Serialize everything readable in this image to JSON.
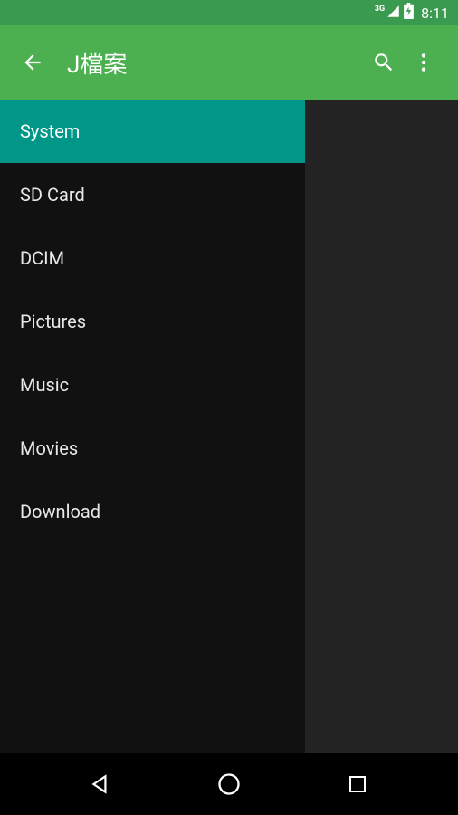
{
  "statusBar": {
    "networkType": "3G",
    "time": "8:11"
  },
  "appBar": {
    "title": "J檔案"
  },
  "drawer": {
    "items": [
      {
        "label": "System",
        "selected": true
      },
      {
        "label": "SD Card",
        "selected": false
      },
      {
        "label": "DCIM",
        "selected": false
      },
      {
        "label": "Pictures",
        "selected": false
      },
      {
        "label": "Music",
        "selected": false
      },
      {
        "label": "Movies",
        "selected": false
      },
      {
        "label": "Download",
        "selected": false
      }
    ]
  }
}
